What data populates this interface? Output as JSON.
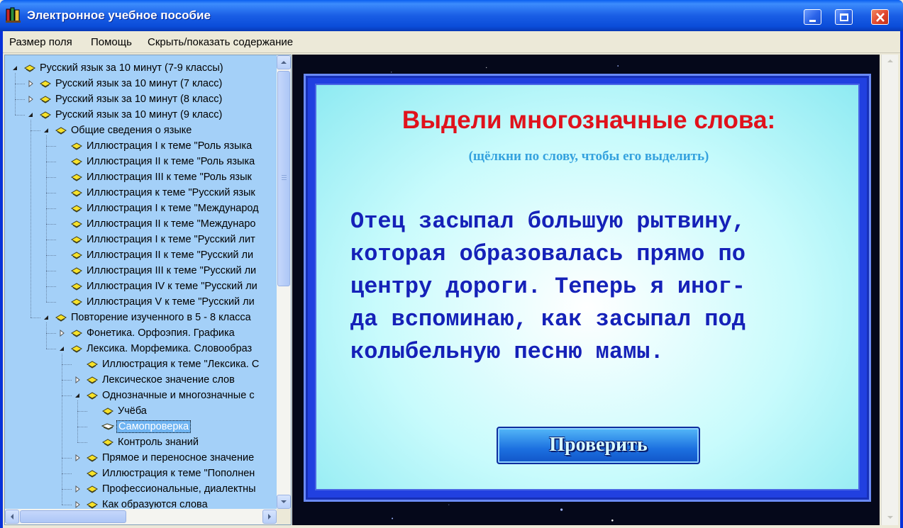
{
  "window": {
    "title": "Электронное учебное пособие",
    "controls": [
      "minimize-icon",
      "maximize-icon",
      "close-icon"
    ]
  },
  "menu": {
    "field_size": "Размер поля",
    "help": "Помощь",
    "toggle_contents": "Скрыть/показать содержание"
  },
  "tree": {
    "items": [
      {
        "label": "Русский язык за 10 минут (7-9 классы)",
        "level": 0,
        "state": "expanded"
      },
      {
        "label": "Русский язык за 10 минут (7 класс)",
        "level": 1,
        "state": "collapsed"
      },
      {
        "label": "Русский язык за 10 минут (8 класс)",
        "level": 1,
        "state": "collapsed"
      },
      {
        "label": "Русский язык за 10 минут (9 класс)",
        "level": 1,
        "state": "expanded"
      },
      {
        "label": "Общие сведения о языке",
        "level": 2,
        "state": "expanded"
      },
      {
        "label": "Иллюстрация I к теме \"Роль языка",
        "level": 3,
        "state": "leaf"
      },
      {
        "label": "Иллюстрация II к теме \"Роль языка",
        "level": 3,
        "state": "leaf"
      },
      {
        "label": "Иллюстрация III к теме \"Роль язык",
        "level": 3,
        "state": "leaf"
      },
      {
        "label": "Иллюстрация к теме \"Русский язык",
        "level": 3,
        "state": "leaf"
      },
      {
        "label": "Иллюстрация I к теме \"Международ",
        "level": 3,
        "state": "leaf"
      },
      {
        "label": "Иллюстрация II к теме \"Междунаро",
        "level": 3,
        "state": "leaf"
      },
      {
        "label": "Иллюстрация I к теме \"Русский лит",
        "level": 3,
        "state": "leaf"
      },
      {
        "label": "Иллюстрация II к теме \"Русский ли",
        "level": 3,
        "state": "leaf"
      },
      {
        "label": "Иллюстрация III к теме \"Русский ли",
        "level": 3,
        "state": "leaf"
      },
      {
        "label": "Иллюстрация IV к теме \"Русский ли",
        "level": 3,
        "state": "leaf"
      },
      {
        "label": "Иллюстрация V к теме \"Русский ли",
        "level": 3,
        "state": "leaf"
      },
      {
        "label": "Повторение изученного в 5 - 8 класса",
        "level": 2,
        "state": "expanded"
      },
      {
        "label": "Фонетика. Орфоэпия. Графика",
        "level": 3,
        "state": "collapsed"
      },
      {
        "label": "Лексика. Морфемика. Словообраз",
        "level": 3,
        "state": "expanded"
      },
      {
        "label": "Иллюстрация к теме \"Лексика. С",
        "level": 4,
        "state": "leaf"
      },
      {
        "label": "Лексическое значение слов",
        "level": 4,
        "state": "collapsed"
      },
      {
        "label": "Однозначные и многозначные с",
        "level": 4,
        "state": "expanded"
      },
      {
        "label": "Учёба",
        "level": 5,
        "state": "leaf"
      },
      {
        "label": "Самопроверка",
        "level": 5,
        "state": "leaf",
        "selected": true
      },
      {
        "label": "Контроль знаний",
        "level": 5,
        "state": "leaf"
      },
      {
        "label": "Прямое и переносное значение",
        "level": 4,
        "state": "collapsed"
      },
      {
        "label": "Иллюстрация к теме \"Пополнен",
        "level": 4,
        "state": "leaf"
      },
      {
        "label": "Профессиональные, диалектны",
        "level": 4,
        "state": "collapsed"
      },
      {
        "label": "Как образуются слова",
        "level": 4,
        "state": "collapsed"
      }
    ]
  },
  "exercise": {
    "title": "Выдели многозначные слова:",
    "hint": "(щёлкни по слову, чтобы его выделить)",
    "lines": [
      "Отец засыпал большую рытвину,",
      "которая образовалась прямо по",
      "центру дороги. Теперь я иног-",
      "да вспоминаю, как засыпал под",
      "колыбельную песню мамы."
    ],
    "check_button": "Проверить"
  },
  "colors": {
    "title_red": "#E0121C",
    "hint_blue": "#35A2DE",
    "text_blue": "#1521B8",
    "tree_bg": "#A4D0F8",
    "stage_bg": "#05081A"
  }
}
